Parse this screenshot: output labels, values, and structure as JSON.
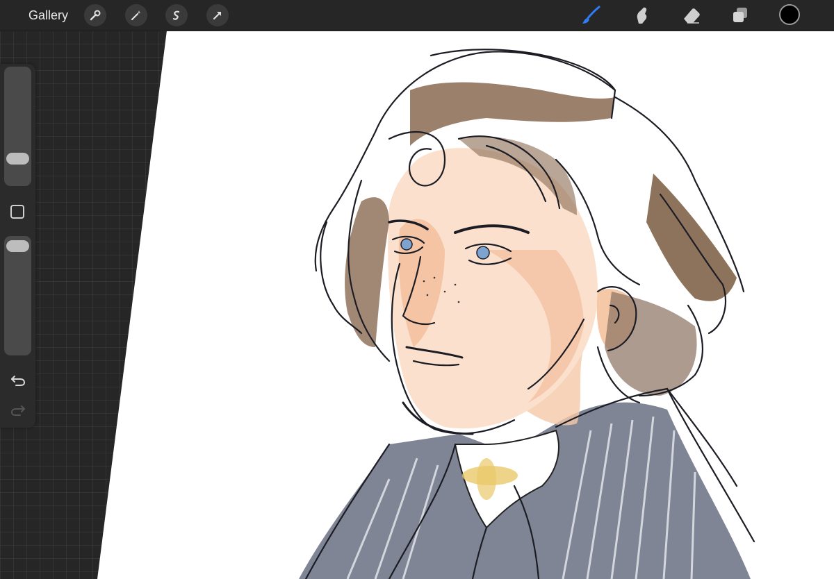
{
  "topbar": {
    "gallery_label": "Gallery",
    "left_tools": [
      {
        "name": "actions",
        "icon": "wrench-icon"
      },
      {
        "name": "adjustments",
        "icon": "magic-wand-icon"
      },
      {
        "name": "selection",
        "icon": "selection-s-icon"
      },
      {
        "name": "transform",
        "icon": "transform-arrow-icon"
      }
    ],
    "right_tools": [
      {
        "name": "brush",
        "icon": "brush-icon",
        "active": true
      },
      {
        "name": "smudge",
        "icon": "smudge-finger-icon"
      },
      {
        "name": "eraser",
        "icon": "eraser-icon"
      },
      {
        "name": "layers",
        "icon": "layers-icon"
      }
    ],
    "current_color": "#000000"
  },
  "sidebar": {
    "brush_size_level": 0.25,
    "opacity_level": 0.95,
    "modify_button": "square-icon",
    "undo": "undo-icon",
    "redo": "redo-icon"
  },
  "colors": {
    "accent": "#2f7df6",
    "toolbar_bg": "#262626",
    "hair": "#7a5a3f",
    "skin": "#f0b48e",
    "coat": "#5a6070",
    "cravat_accent": "#e9c96a",
    "eyes": "#7ea3cf"
  }
}
